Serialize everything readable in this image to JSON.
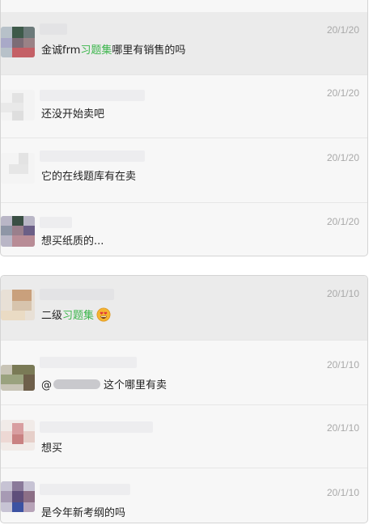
{
  "group_a": {
    "messages": [
      {
        "date": "20/1/20",
        "text_pre": "金诚frm",
        "text_link": "习题集",
        "text_post": "哪里有销售的吗"
      },
      {
        "date": "20/1/20",
        "text": "还没开始卖吧"
      },
      {
        "date": "20/1/20",
        "text": "它的在线题库有在卖"
      },
      {
        "date": "20/1/20",
        "text": "想买纸质的..."
      }
    ]
  },
  "group_b": {
    "messages": [
      {
        "date": "20/1/10",
        "text_pre": "二级",
        "text_link": "习题集",
        "emoji": "heart-eyes-emoji"
      },
      {
        "date": "20/1/10",
        "mention_prefix": "@",
        "text": "这个哪里有卖"
      },
      {
        "date": "20/1/10",
        "text": "想买"
      },
      {
        "date": "20/1/10",
        "text": "是今年新考纲的吗"
      }
    ]
  },
  "colors": {
    "link_green": "#3cb64c",
    "date_gray": "#a9a9a9",
    "selected_row": "#ebebeb"
  }
}
